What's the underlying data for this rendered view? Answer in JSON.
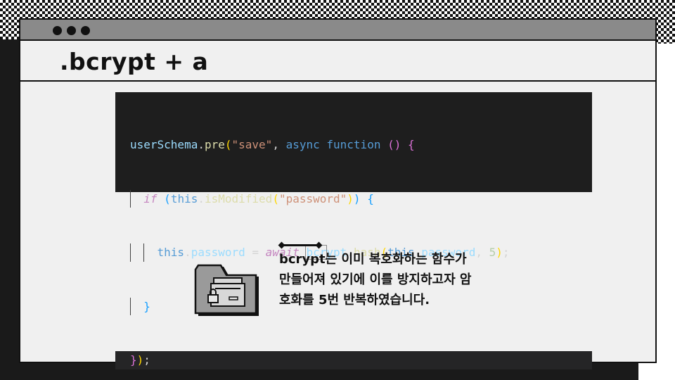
{
  "slide": {
    "title": ".bcrypt + a",
    "code": {
      "lines": [
        "userSchema.pre(\"save\", async function () {",
        "  if (this.isModified(\"password\")) {",
        "    this.password = await bcrypt.hash(this.password, 5);",
        "  }",
        "});"
      ]
    },
    "description": "bcrypt는 이미 복호화하는 함수가 만들어져 있기에 이를 방지하고자 암호화를 5번 반복하였습니다."
  },
  "icons": {
    "folder": "locked-folder-icon",
    "window_controls": [
      "dot-icon",
      "dot-icon",
      "dot-icon"
    ]
  },
  "colors": {
    "titlebar": "#8a8a8a",
    "window_bg": "#f0f0f0",
    "code_bg": "#1e1e1e",
    "accent_dark": "#111111"
  }
}
